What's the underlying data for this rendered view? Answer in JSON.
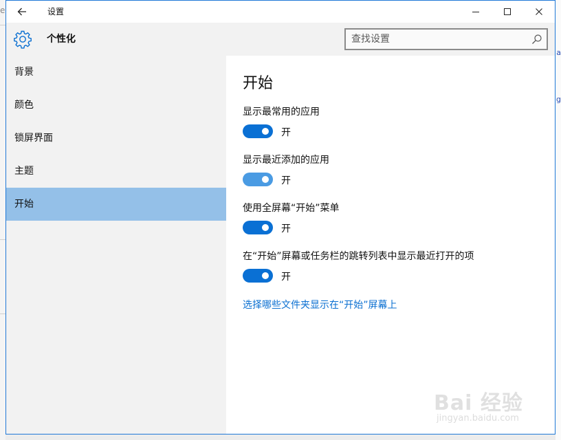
{
  "window": {
    "title": "设置",
    "accent_color": "#1e78d7"
  },
  "header": {
    "title": "个性化",
    "icon": "gear-icon",
    "search": {
      "placeholder": "查找设置",
      "value": ""
    }
  },
  "sidebar": {
    "items": [
      {
        "label": "背景",
        "selected": false
      },
      {
        "label": "颜色",
        "selected": false
      },
      {
        "label": "锁屏界面",
        "selected": false
      },
      {
        "label": "主题",
        "selected": false
      },
      {
        "label": "开始",
        "selected": true
      }
    ],
    "selected_color": "#94c0e8"
  },
  "main": {
    "title": "开始",
    "settings": [
      {
        "label": "显示最常用的应用",
        "state": "开",
        "on": true
      },
      {
        "label": "显示最近添加的应用",
        "state": "开",
        "on": true
      },
      {
        "label": "使用全屏幕“开始”菜单",
        "state": "开",
        "on": true
      },
      {
        "label": "在“开始”屏幕或任务栏的跳转列表中显示最近打开的项",
        "state": "开",
        "on": true
      }
    ],
    "link": "选择哪些文件夹显示在“开始”屏幕上",
    "toggle_color": "#0a70d4",
    "link_color": "#0a6fd1"
  },
  "watermark": {
    "brand": "Bai 经验",
    "url": "jingyan.baidu.com"
  }
}
